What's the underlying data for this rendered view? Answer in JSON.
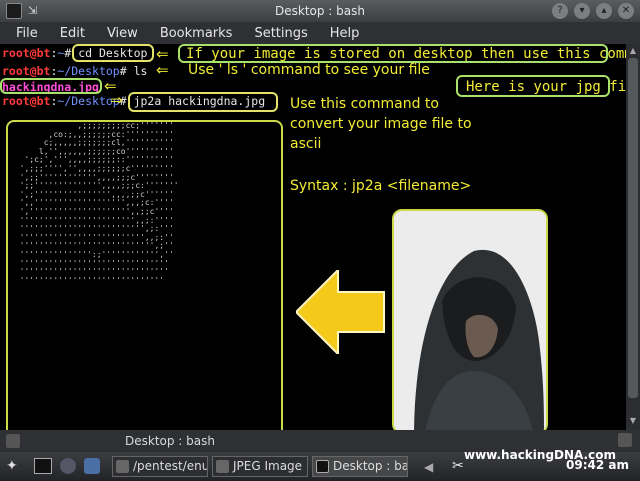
{
  "window": {
    "title": "Desktop : bash"
  },
  "menu": [
    "File",
    "Edit",
    "View",
    "Bookmarks",
    "Settings",
    "Help"
  ],
  "terminal": {
    "lines": [
      {
        "user": "root@bt",
        "sep": ":",
        "path": "~",
        "prompt": "#",
        "cmd": " cd Desktop"
      },
      {
        "user": "root@bt",
        "sep": ":",
        "path": "~/Desktop",
        "prompt": "#",
        "cmd": " ls"
      },
      {
        "file": "hackingdna.jpg"
      },
      {
        "user": "root@bt",
        "sep": ":",
        "path": "~/Desktop",
        "prompt": "#",
        "cmd": " jp2a hackingdna.jpg"
      }
    ],
    "ascii_art": "              ,;;;;;;;;;cc;'''''''\n        ,co:;,,;;;;;;cc:''''''''''\n       c;,,,,,;;;;;;;cl,''''''''''\n      l,'',,,,,,;;;;;;co''''''''''\n   ';c;',''',,,,;;;;;;::''''''''''\n  ',;;;'''','',,,,;;;;;;c'''''''''\n  ',;;'''''''''''',,,,;;;c''''''''\n  ';;'''''''''''''',,,,;;;c:'''''''\n  ',;'''''''''''''''',,,,;;c''''''\n  ',,''''''''''''''''''',,,;c:''''\n  ',''''''''''''''''''''',,;;c''''\n  '''''''''''''''''''''''',,;:''''\n  '''''''''''''''''''''''''',;:'''\n  '''''''''''''''''''''''''',,;:''\n  '''''''''''''''''''''''''''',;''\n  ''''''''''''''':;'''''''''''',''\n  '''''''''''''''''''''''''''''''\n  '''''''''''''''''''''''''''''''\n  ''''''''''''''''''''''''''''''"
  },
  "annotations": {
    "cd": "If your image is stored on desktop then use this command",
    "ls": "Use  ' ls ' command to see your file",
    "jpg": "Here is your jpg file",
    "convert": "Use this command to\nconvert your image file to\nascii",
    "syntax": "Syntax : jp2a <filename>"
  },
  "bottom_tab": "Desktop : bash",
  "taskbar": {
    "tasks": [
      "/pentest/enu",
      "JPEG Image",
      "Desktop : bas"
    ],
    "watermark": "www.hackingDNA.com",
    "clock": "09:42 am"
  },
  "colors": {
    "accent_yellow": "#f2ec34",
    "box_green": "#a9e26a",
    "root_red": "#ff3a3a"
  }
}
